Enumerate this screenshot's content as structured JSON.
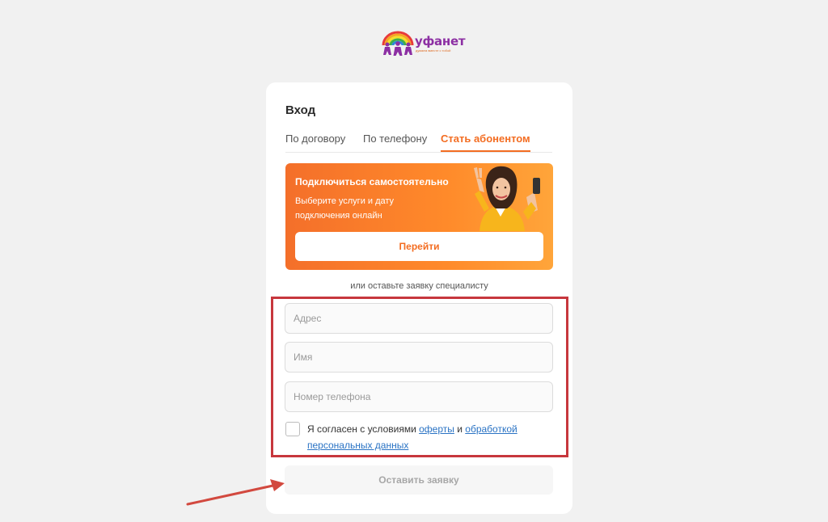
{
  "logo": {
    "name": "уфанет",
    "tagline": "думаем вместе с тобой"
  },
  "login": {
    "title": "Вход",
    "tabs": [
      {
        "label": "По договору",
        "active": false
      },
      {
        "label": "По телефону",
        "active": false
      },
      {
        "label": "Стать абонентом",
        "active": true
      }
    ]
  },
  "promo": {
    "title": "Подключиться самостоятельно",
    "text": "Выберите услуги и дату подключения онлайн",
    "button_label": "Перейти"
  },
  "request": {
    "or_text": "или оставьте заявку специалисту",
    "address_placeholder": "Адрес",
    "name_placeholder": "Имя",
    "phone_placeholder": "Номер телефона",
    "consent_prefix": "Я согласен с условиями",
    "offer_link": "оферты",
    "and_text": "и",
    "data_link": "обработкой персональных данных",
    "submit_label": "Оставить заявку"
  },
  "colors": {
    "accent": "#f36d22",
    "highlight": "#c7373d",
    "link": "#2a73c4"
  }
}
